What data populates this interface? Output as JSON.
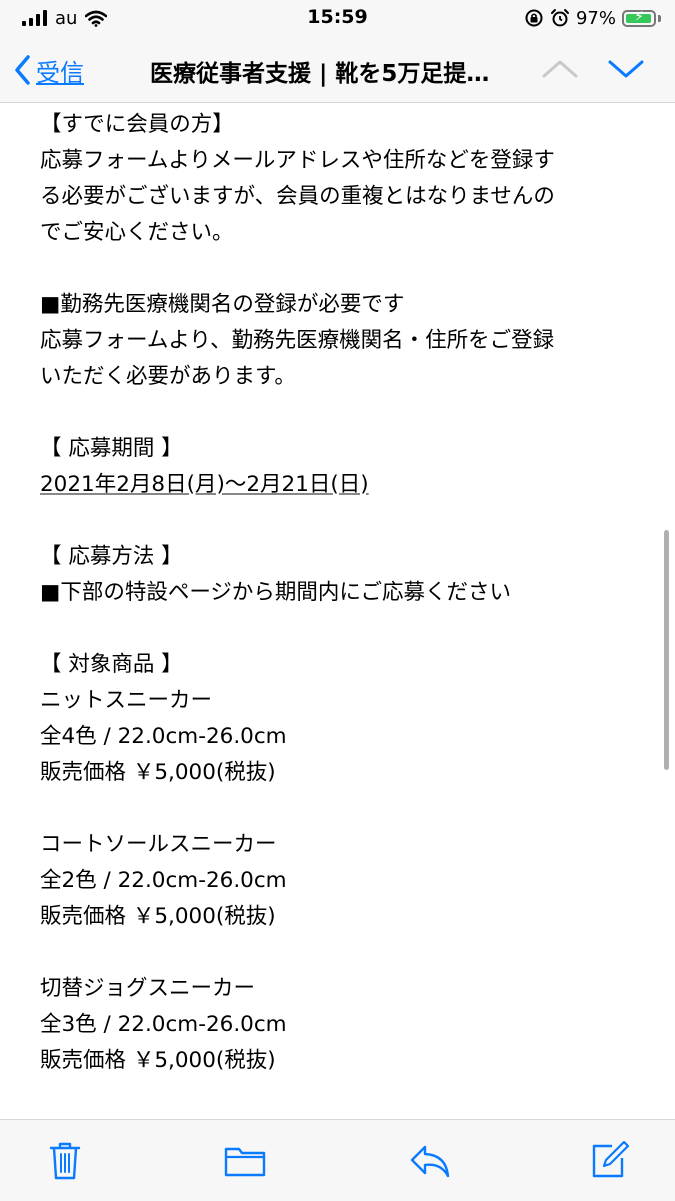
{
  "status_bar": {
    "carrier": "au",
    "time": "15:59",
    "battery": "97%",
    "battery_level": 0.97
  },
  "nav": {
    "back_label": "受信",
    "title": "医療従事者支援 | 靴を5万足提…"
  },
  "colors": {
    "accent": "#0a7aff",
    "battery_green": "#34c759"
  },
  "body_lines": [
    "【すでに会員の方】",
    "応募フォームよりメールアドレスや住所などを登録す",
    "る必要がございますが、会員の重複とはなりませんの",
    "でご安心ください。",
    "",
    "■勤務先医療機関名の登録が必要です",
    "応募フォームより、勤務先医療機関名・住所をご登録",
    "いただく必要があります。",
    "",
    "【 応募期間 】",
    "2021年2月8日(月)〜2月21日(日)",
    "",
    "【 応募方法 】",
    "■下部の特設ページから期間内にご応募ください",
    "",
    "【 対象商品 】",
    "ニットスニーカー",
    "全4色 / 22.0cm-26.0cm",
    "販売価格 ￥5,000(税抜)",
    "",
    "コートソールスニーカー",
    "全2色 / 22.0cm-26.0cm",
    "販売価格 ￥5,000(税抜)",
    "",
    "切替ジョグスニーカー",
    "全3色 / 22.0cm-26.0cm",
    "販売価格 ￥5,000(税抜)"
  ],
  "icons": {
    "back": "chevron-left-icon",
    "prev": "chevron-up-icon",
    "next": "chevron-down-icon",
    "trash": "trash-icon",
    "folder": "folder-icon",
    "reply": "reply-icon",
    "compose": "compose-icon"
  }
}
